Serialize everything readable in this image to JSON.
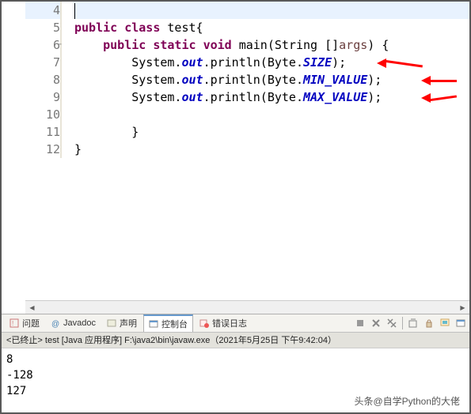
{
  "editor": {
    "lines": [
      {
        "no": 4,
        "html": "<span class='cursor'></span>"
      },
      {
        "no": 5,
        "html": "<span class='kw'>public</span> <span class='kw'>class</span> test{"
      },
      {
        "no": 6,
        "html": "    <span class='kw'>public</span> <span class='kw'>static</span> <span class='kw'>void</span> main(String []<span class='args'>args</span>) {",
        "folded": true
      },
      {
        "no": 7,
        "html": "        System.<span class='field'>out</span>.println(Byte.<span class='field'>SIZE</span>);",
        "arrow": true
      },
      {
        "no": 8,
        "html": "        System.<span class='field'>out</span>.println(Byte.<span class='field'>MIN_VALUE</span>);",
        "arrow": true
      },
      {
        "no": 9,
        "html": "        System.<span class='field'>out</span>.println(Byte.<span class='field'>MAX_VALUE</span>);",
        "arrow": true
      },
      {
        "no": 10,
        "html": ""
      },
      {
        "no": 11,
        "html": "        }"
      },
      {
        "no": 12,
        "html": "}"
      }
    ]
  },
  "tabs": {
    "problems": "问题",
    "javadoc": "Javadoc",
    "declaration": "声明",
    "console": "控制台",
    "errorlog": "错误日志"
  },
  "terminal": {
    "status": "<已终止> test [Java 应用程序] F:\\java2\\bin\\javaw.exe（2021年5月25日 下午9:42:04）"
  },
  "console": {
    "output": [
      "8",
      "-128",
      "127"
    ]
  },
  "watermark": "头条@自学Python的大佬"
}
